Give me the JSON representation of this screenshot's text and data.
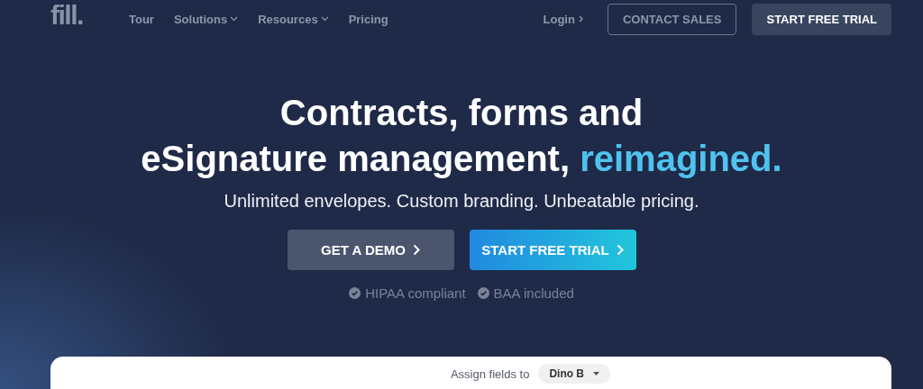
{
  "nav": {
    "logo": "fill.",
    "links": [
      {
        "label": "Tour",
        "has_menu": false
      },
      {
        "label": "Solutions",
        "has_menu": true
      },
      {
        "label": "Resources",
        "has_menu": true
      },
      {
        "label": "Pricing",
        "has_menu": false
      }
    ],
    "login": "Login",
    "contact": "CONTACT SALES",
    "trial": "START FREE TRIAL"
  },
  "hero": {
    "lines": [
      "Contracts, forms and",
      "eSignature management,"
    ],
    "highlight": "reimagined.",
    "subtitle": "Unlimited envelopes. Custom branding. Unbeatable pricing.",
    "buttons": [
      {
        "label": "GET A DEMO",
        "kind": "secondary"
      },
      {
        "label": "START FREE TRIAL",
        "kind": "primary"
      }
    ],
    "badges": [
      "HIPAA compliant",
      "BAA included"
    ]
  },
  "preview": {
    "assign_label": "Assign fields to",
    "assignee": "Dino B"
  }
}
